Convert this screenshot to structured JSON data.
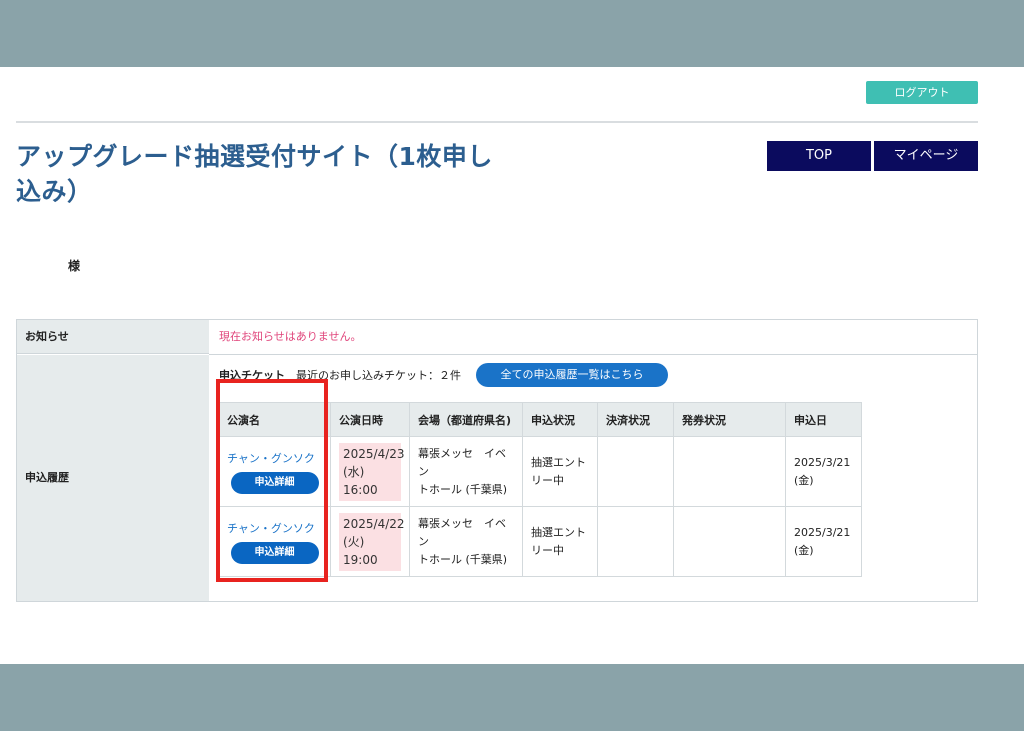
{
  "header": {
    "logout_label": "ログアウト",
    "site_title": "アップグレード抽選受付サイト（1枚申し込み）",
    "nav": {
      "top_label": "TOP",
      "mypage_label": "マイページ"
    }
  },
  "user": {
    "name_suffix": "様"
  },
  "notice": {
    "label": "お知らせ",
    "text": "現在お知らせはありません。"
  },
  "history": {
    "label": "申込履歴",
    "ticket_label": "申込チケット",
    "recent_count": "最近のお申し込みチケット：２件",
    "all_history_button": "全ての申込履歴一覧はこちら",
    "columns": [
      "公演名",
      "公演日時",
      "会場（都道府県名)",
      "申込状況",
      "決済状況",
      "発券状況",
      "申込日"
    ],
    "rows": [
      {
        "performance": "チャン・グンソク",
        "detail_button": "申込詳細",
        "date_line1": "2025/4/23",
        "date_line2": "(水)",
        "date_line3": "16:00",
        "venue_line1": "幕張メッセ　イベン",
        "venue_line2": "トホール (千葉県)",
        "status_line1": "抽選エント",
        "status_line2": "リー中",
        "payment": "",
        "issuance": "",
        "applied_line1": "2025/3/21",
        "applied_line2": "(金)"
      },
      {
        "performance": "チャン・グンソク",
        "detail_button": "申込詳細",
        "date_line1": "2025/4/22",
        "date_line2": "(火)",
        "date_line3": "19:00",
        "venue_line1": "幕張メッセ　イベン",
        "venue_line2": "トホール (千葉県)",
        "status_line1": "抽選エント",
        "status_line2": "リー中",
        "payment": "",
        "issuance": "",
        "applied_line1": "2025/3/21",
        "applied_line2": "(金)"
      }
    ]
  },
  "colors": {
    "accent_teal": "#3fbfb3",
    "nav_navy": "#0b0b5e",
    "title_blue": "#2c5e8f",
    "button_blue": "#0a66c2",
    "highlight_red": "#e8231f"
  }
}
